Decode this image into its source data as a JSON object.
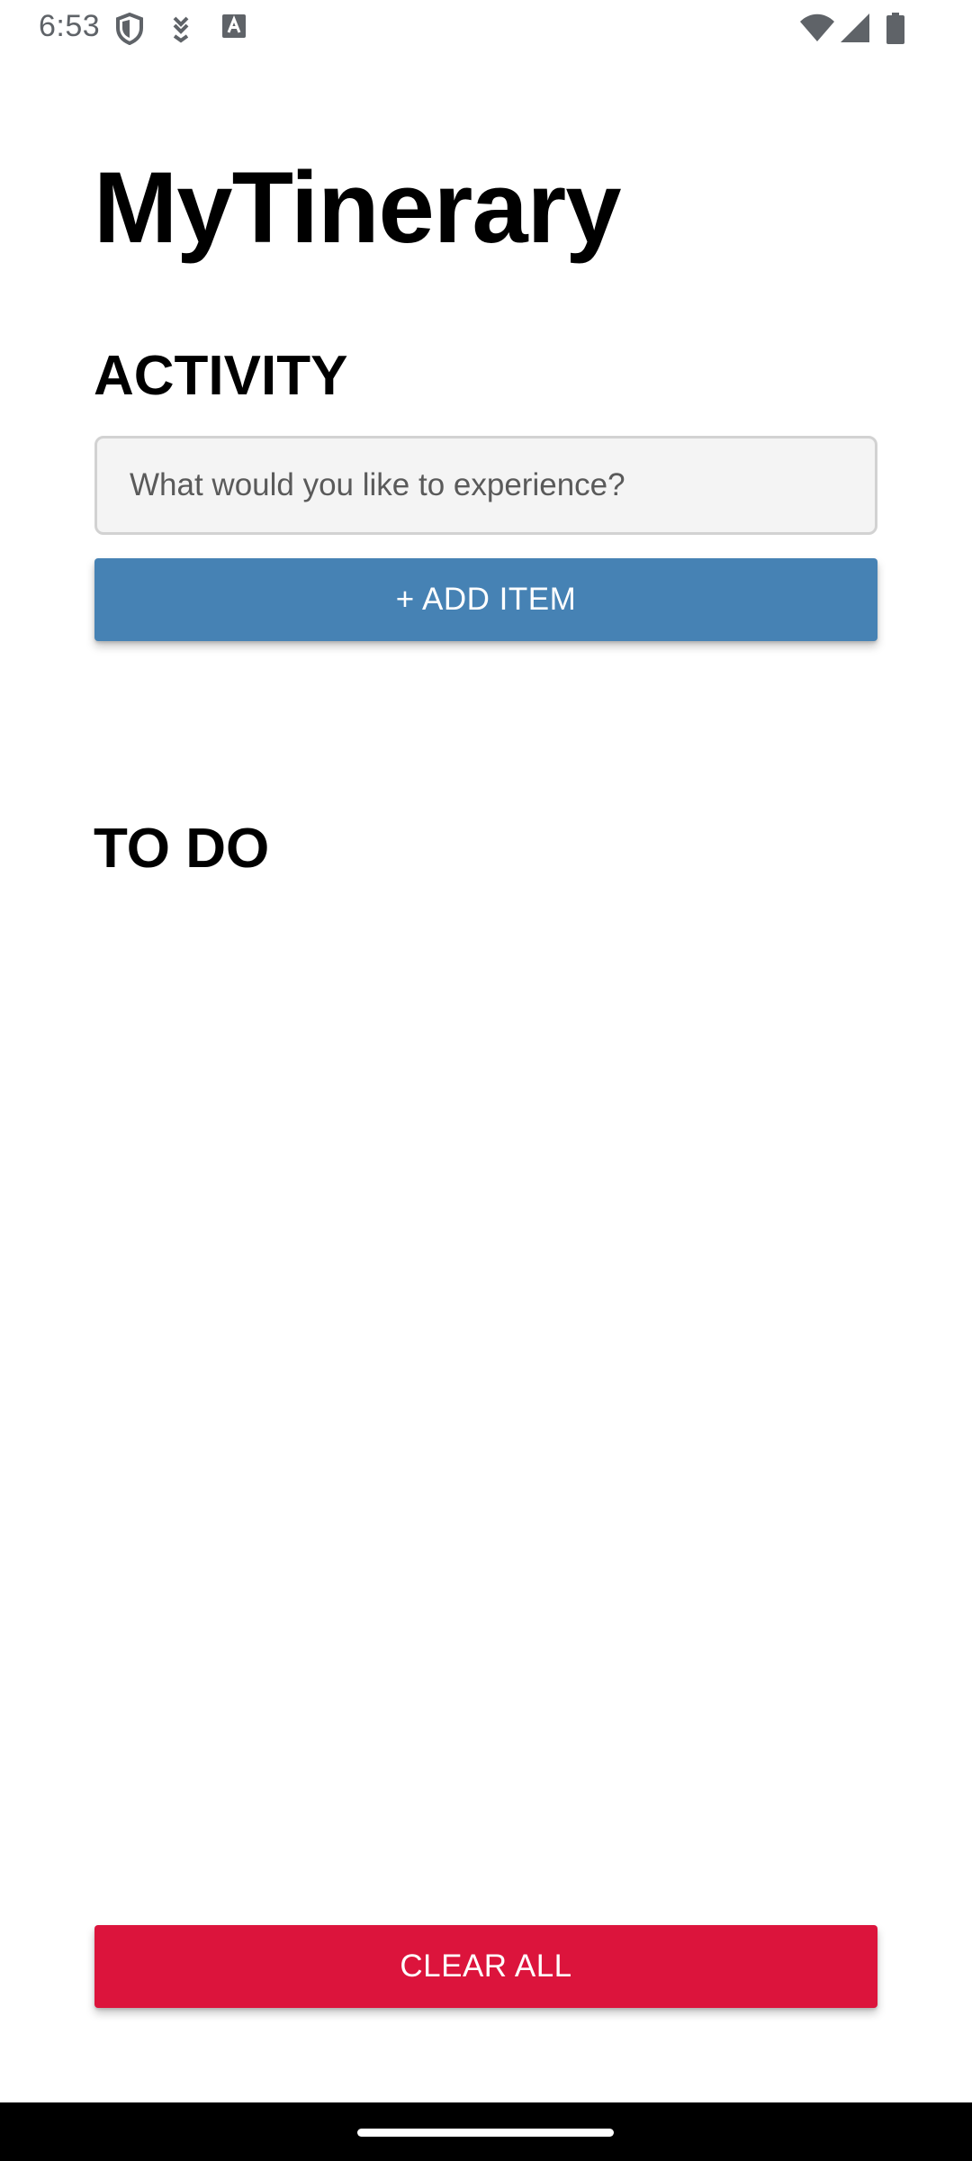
{
  "status_bar": {
    "time": "6:53",
    "left_icons": [
      "shield-icon",
      "download-icon",
      "text-a-icon"
    ],
    "right_icons": [
      "wifi-icon",
      "cell-signal-icon",
      "battery-icon"
    ]
  },
  "app": {
    "title": "MyTinerary"
  },
  "activity": {
    "heading": "ACTIVITY",
    "input_placeholder": "What would you like to experience?",
    "input_value": "",
    "add_button_label": "+ ADD ITEM"
  },
  "todo": {
    "heading": "TO DO",
    "items": []
  },
  "footer": {
    "clear_button_label": "CLEAR ALL"
  },
  "colors": {
    "add_button": "#4682b4",
    "clear_button": "#dc143c",
    "status_icons": "#5f6368"
  }
}
